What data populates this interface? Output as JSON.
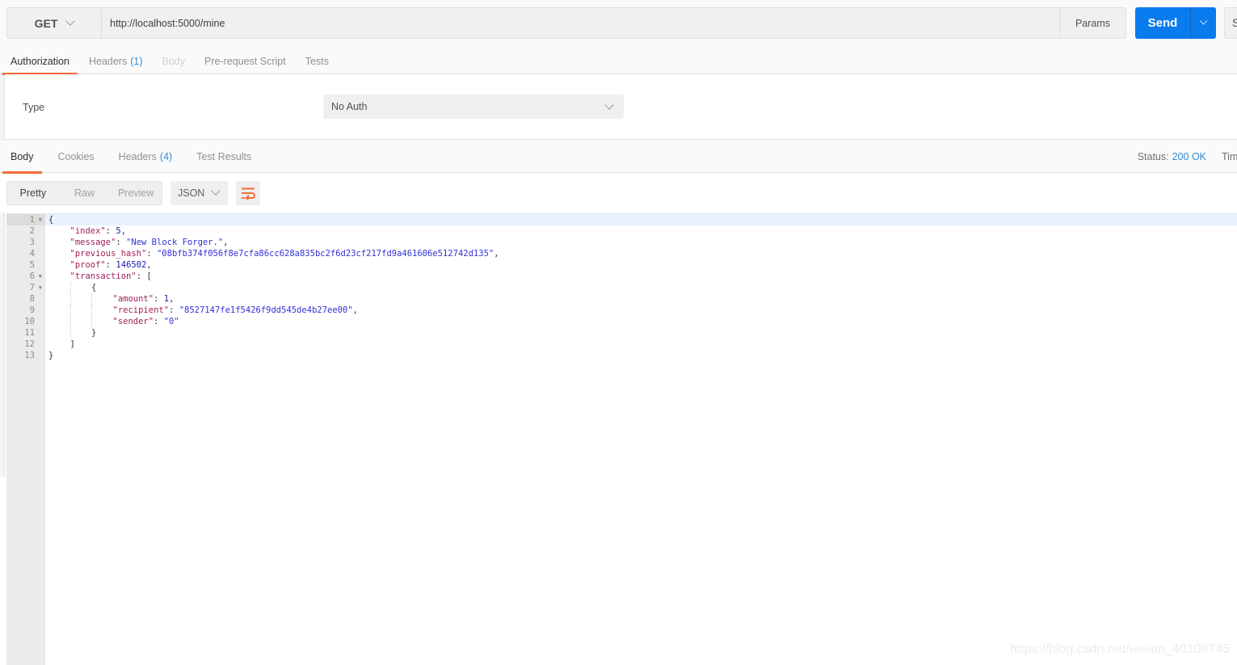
{
  "request": {
    "method": "GET",
    "url": "http://localhost:5000/mine",
    "params_label": "Params",
    "send_label": "Send",
    "save_label_partial": "S"
  },
  "request_tabs": [
    {
      "label": "Authorization",
      "count": "",
      "state": "active"
    },
    {
      "label": "Headers",
      "count": "(1)",
      "state": "normal"
    },
    {
      "label": "Body",
      "count": "",
      "state": "disabled"
    },
    {
      "label": "Pre-request Script",
      "count": "",
      "state": "normal"
    },
    {
      "label": "Tests",
      "count": "",
      "state": "normal"
    }
  ],
  "auth": {
    "type_label": "Type",
    "type_value": "No Auth"
  },
  "response_tabs": [
    {
      "label": "Body",
      "count": "",
      "state": "active"
    },
    {
      "label": "Cookies",
      "count": "",
      "state": "normal"
    },
    {
      "label": "Headers",
      "count": "(4)",
      "state": "normal"
    },
    {
      "label": "Test Results",
      "count": "",
      "state": "normal"
    }
  ],
  "response_status": {
    "label": "Status:",
    "value": "200 OK",
    "time_label_partial": "Tim"
  },
  "view": {
    "modes": [
      "Pretty",
      "Raw",
      "Preview"
    ],
    "active_mode": "Pretty",
    "format": "JSON",
    "wrap_icon": "wrap-lines-icon"
  },
  "colors": {
    "accent_orange": "#f26b3a",
    "send_blue": "#097bed",
    "status_blue": "#2f8ad9",
    "json_key": "#a11f59",
    "json_string": "#3131d6",
    "json_number": "#1a1aa6"
  },
  "response_body": {
    "lines": [
      {
        "num": "1",
        "fold": true,
        "active": true,
        "indent": 0,
        "tokens": [
          {
            "t": "p",
            "v": "{"
          }
        ]
      },
      {
        "num": "2",
        "fold": false,
        "indent": 1,
        "tokens": [
          {
            "t": "k",
            "v": "\"index\""
          },
          {
            "t": "p",
            "v": ": "
          },
          {
            "t": "n",
            "v": "5"
          },
          {
            "t": "p",
            "v": ","
          }
        ]
      },
      {
        "num": "3",
        "fold": false,
        "indent": 1,
        "tokens": [
          {
            "t": "k",
            "v": "\"message\""
          },
          {
            "t": "p",
            "v": ": "
          },
          {
            "t": "s",
            "v": "\"New Block Forger.\""
          },
          {
            "t": "p",
            "v": ","
          }
        ]
      },
      {
        "num": "4",
        "fold": false,
        "indent": 1,
        "tokens": [
          {
            "t": "k",
            "v": "\"previous_hash\""
          },
          {
            "t": "p",
            "v": ": "
          },
          {
            "t": "s",
            "v": "\"08bfb374f056f8e7cfa86cc628a835bc2f6d23cf217fd9a461606e512742d135\""
          },
          {
            "t": "p",
            "v": ","
          }
        ]
      },
      {
        "num": "5",
        "fold": false,
        "indent": 1,
        "tokens": [
          {
            "t": "k",
            "v": "\"proof\""
          },
          {
            "t": "p",
            "v": ": "
          },
          {
            "t": "n",
            "v": "146502"
          },
          {
            "t": "p",
            "v": ","
          }
        ]
      },
      {
        "num": "6",
        "fold": true,
        "indent": 1,
        "tokens": [
          {
            "t": "k",
            "v": "\"transaction\""
          },
          {
            "t": "p",
            "v": ": ["
          }
        ]
      },
      {
        "num": "7",
        "fold": true,
        "indent": 2,
        "tokens": [
          {
            "t": "p",
            "v": "{"
          }
        ]
      },
      {
        "num": "8",
        "fold": false,
        "indent": 3,
        "tokens": [
          {
            "t": "k",
            "v": "\"amount\""
          },
          {
            "t": "p",
            "v": ": "
          },
          {
            "t": "n",
            "v": "1"
          },
          {
            "t": "p",
            "v": ","
          }
        ]
      },
      {
        "num": "9",
        "fold": false,
        "indent": 3,
        "tokens": [
          {
            "t": "k",
            "v": "\"recipient\""
          },
          {
            "t": "p",
            "v": ": "
          },
          {
            "t": "s",
            "v": "\"8527147fe1f5426f9dd545de4b27ee00\""
          },
          {
            "t": "p",
            "v": ","
          }
        ]
      },
      {
        "num": "10",
        "fold": false,
        "indent": 3,
        "tokens": [
          {
            "t": "k",
            "v": "\"sender\""
          },
          {
            "t": "p",
            "v": ": "
          },
          {
            "t": "s",
            "v": "\"0\""
          }
        ]
      },
      {
        "num": "11",
        "fold": false,
        "indent": 2,
        "tokens": [
          {
            "t": "p",
            "v": "}"
          }
        ]
      },
      {
        "num": "12",
        "fold": false,
        "indent": 1,
        "tokens": [
          {
            "t": "p",
            "v": "]"
          }
        ]
      },
      {
        "num": "13",
        "fold": false,
        "indent": 0,
        "tokens": [
          {
            "t": "p",
            "v": "}"
          }
        ]
      }
    ]
  },
  "watermark": "https://blog.csdn.net/weixin_40108745"
}
